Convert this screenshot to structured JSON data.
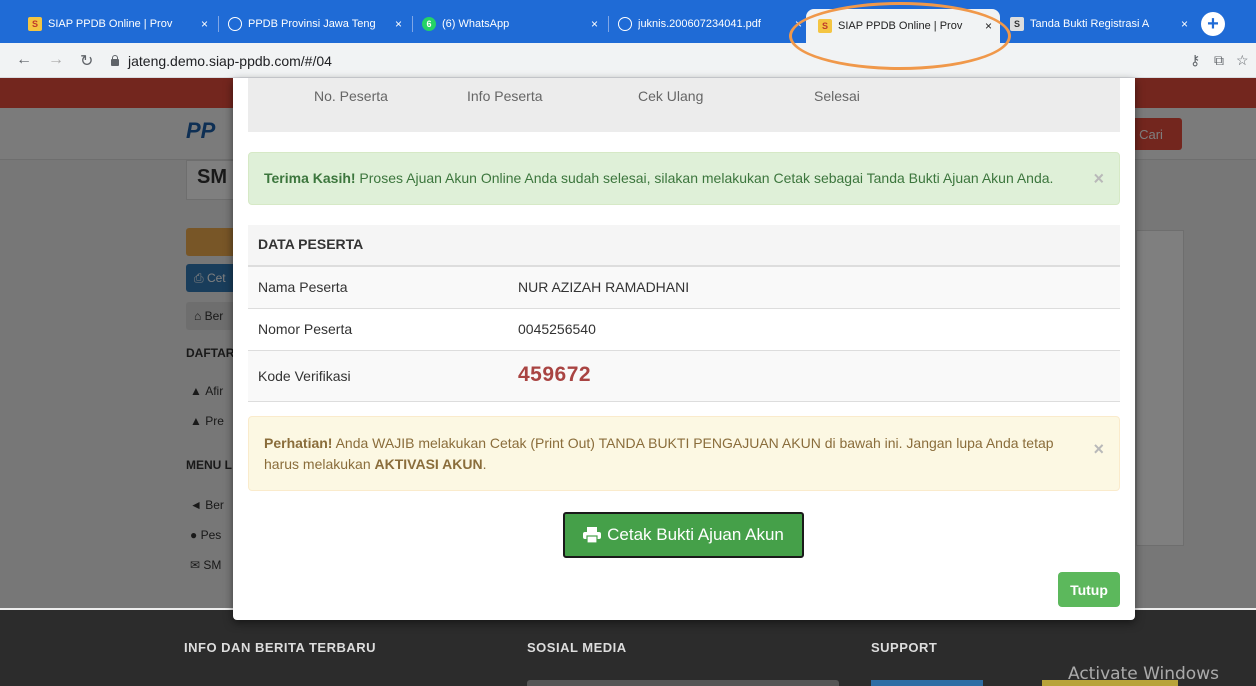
{
  "browser": {
    "tabs": [
      {
        "title": "SIAP PPDB Online | Prov",
        "close": "×"
      },
      {
        "title": "PPDB Provinsi Jawa Teng",
        "close": "×"
      },
      {
        "title": "(6) WhatsApp",
        "close": "×",
        "badge": "6"
      },
      {
        "title": "juknis.200607234041.pdf",
        "close": "×"
      },
      {
        "title": "SIAP PPDB Online | Prov",
        "close": "×"
      },
      {
        "title": "Tanda Bukti Registrasi A",
        "close": "×"
      }
    ],
    "new_tab": "+",
    "url": "jateng.demo.siap-ppdb.com/#/04"
  },
  "background_page": {
    "logo": "PP",
    "school": "SM",
    "search_button": "Cari",
    "sidebar": {
      "cetak": "Cet",
      "beranda": "Ber",
      "daftar_heading": "DAFTAR",
      "afirmasi": "Afir",
      "prestasi": "Pre",
      "menu_heading": "MENU L",
      "berita": "Ber",
      "pesan": "Pes",
      "sms": "SM"
    },
    "footer": {
      "col1": "INFO DAN BERITA TERBARU",
      "col2": "SOSIAL MEDIA",
      "col3": "SUPPORT"
    }
  },
  "watermark": "Activate Windows",
  "modal": {
    "wizard_steps": [
      "No. Peserta",
      "Info Peserta",
      "Cek Ulang",
      "Selesai"
    ],
    "success_alert": {
      "strong": "Terima Kasih!",
      "text": " Proses Ajuan Akun Online Anda sudah selesai, silakan melakukan Cetak sebagai Tanda Bukti Ajuan Akun Anda.",
      "close": "×"
    },
    "data_peserta": {
      "heading": "DATA PESERTA",
      "nama_label": "Nama Peserta",
      "nama_value": "NUR AZIZAH RAMADHANI",
      "nomor_label": "Nomor Peserta",
      "nomor_value": "0045256540",
      "kode_label": "Kode Verifikasi",
      "kode_value": "459672"
    },
    "warning_alert": {
      "strong": "Perhatian!",
      "text": " Anda WAJIB melakukan Cetak (Print Out) TANDA BUKTI PENGAJUAN AKUN di bawah ini. Jangan lupa Anda tetap harus melakukan ",
      "strong2": "AKTIVASI AKUN",
      "text2": ".",
      "close": "×"
    },
    "print_button": "Cetak Bukti Ajuan Akun",
    "close_button": "Tutup"
  },
  "colors": {
    "tab_strip": "#1f6bd6",
    "success_bg": "#dff0d8",
    "warning_bg": "#fcf8e3",
    "print_button": "#45a049",
    "tutup_button": "#5cb85c",
    "verification_code": "#a94442",
    "highlight_ring": "#f0984a"
  }
}
